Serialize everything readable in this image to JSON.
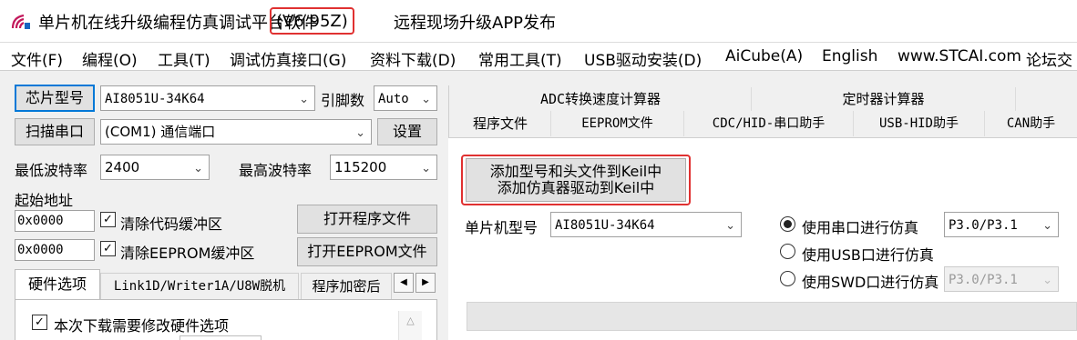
{
  "title": {
    "main": "单片机在线升级编程仿真调试平台软件",
    "version": "(V6.95Z)",
    "rest": "远程现场升级APP发布"
  },
  "menu": {
    "items": [
      "文件(F)",
      "编程(O)",
      "工具(T)",
      "调试仿真接口(G)",
      "资料下载(D)",
      "常用工具(T)",
      "USB驱动安装(D)",
      "AiCube(A)",
      "English",
      "www.STCAI.com",
      "论坛交"
    ]
  },
  "left": {
    "chip_button": "芯片型号",
    "chip_value": "AI8051U-34K64",
    "pin_label": "引脚数",
    "pin_value": "Auto",
    "scan_button": "扫描串口",
    "port_value": "(COM1) 通信端口",
    "settings_button": "设置",
    "min_baud_label": "最低波特率",
    "min_baud_value": "2400",
    "max_baud_label": "最高波特率",
    "max_baud_value": "115200",
    "start_addr_label": "起始地址",
    "addr1": "0x0000",
    "clear_code_label": "清除代码缓冲区",
    "open_prog_button": "打开程序文件",
    "addr2": "0x0000",
    "clear_eeprom_label": "清除EEPROM缓冲区",
    "open_eeprom_button": "打开EEPROM文件",
    "tabs": [
      "硬件选项",
      "Link1D/Writer1A/U8W脱机",
      "程序加密后"
    ],
    "hw_check_label": "本次下载需要修改硬件选项"
  },
  "right": {
    "tabs_top": [
      "ADC转换速度计算器",
      "定时器计算器"
    ],
    "tabs_bottom": [
      "程序文件",
      "EEPROM文件",
      "CDC/HID-串口助手",
      "USB-HID助手",
      "CAN助手"
    ],
    "keil_button_line1": "添加型号和头文件到Keil中",
    "keil_button_line2": "添加仿真器驱动到Keil中",
    "mcu_label": "单片机型号",
    "mcu_value": "AI8051U-34K64",
    "radio_serial": "使用串口进行仿真",
    "radio_usb": "使用USB口进行仿真",
    "radio_swd": "使用SWD口进行仿真",
    "serial_pins": "P3.0/P3.1",
    "swd_pins": "P3.0/P3.1"
  },
  "colors": {
    "highlight": "#e03131",
    "focus": "#0078d7",
    "icon": "#c2185b"
  }
}
